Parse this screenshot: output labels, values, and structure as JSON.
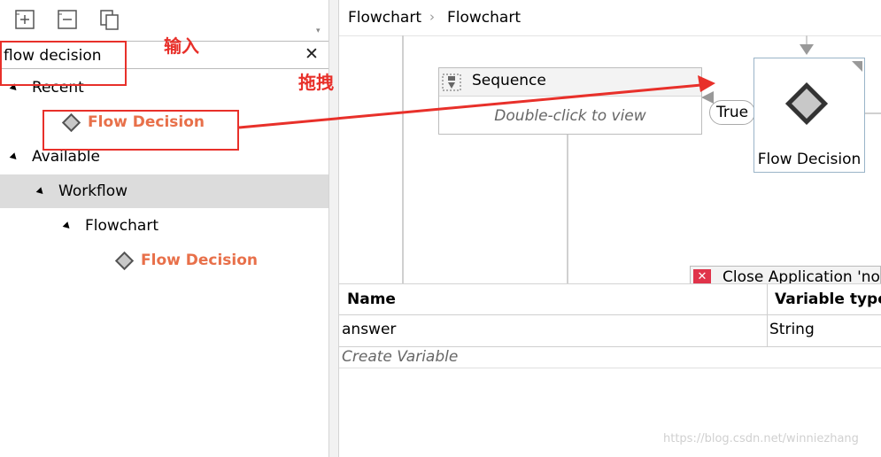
{
  "activities_panel": {
    "search": {
      "value": "flow decision",
      "placeholder": ""
    },
    "tree": {
      "recent_label": "Recent",
      "recent_item": "Flow Decision",
      "available_label": "Available",
      "workflow_label": "Workflow",
      "flowchart_label": "Flowchart",
      "flowchart_item": "Flow Decision"
    }
  },
  "breadcrumb": {
    "items": [
      "Flowchart",
      "Flowchart"
    ]
  },
  "designer": {
    "sequence_title": "Sequence",
    "sequence_hint": "Double-click to view",
    "true_label": "True",
    "flow_decision_label": "Flow Decision",
    "close_app_label": "Close Application 'no"
  },
  "variables": {
    "columns": [
      "Name",
      "Variable type"
    ],
    "rows": [
      {
        "name": "answer",
        "type": "String"
      }
    ],
    "create_label": "Create Variable"
  },
  "annotations": {
    "input": "输入",
    "drag": "拖拽"
  },
  "watermark": "https://blog.csdn.net/winniezhang",
  "colors": {
    "accent": "#e8704a",
    "annotation": "#e8302a",
    "selected_row": "#dcdcdc"
  }
}
